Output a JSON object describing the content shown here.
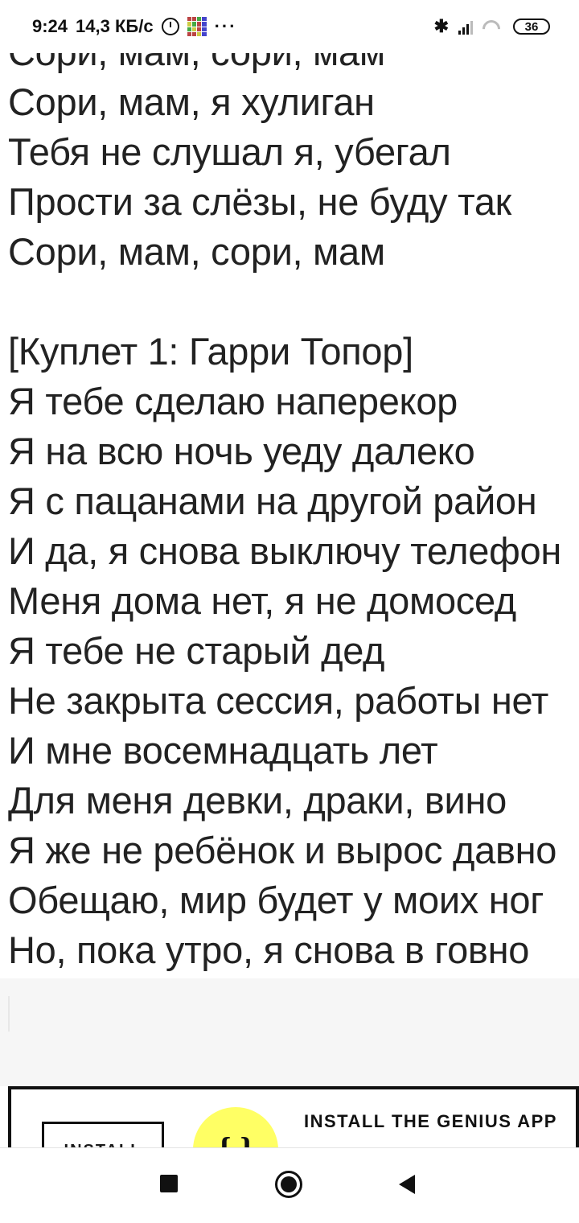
{
  "status_bar": {
    "time": "9:24",
    "speed": "14,3 КБ/с",
    "overflow": "···",
    "battery": "36",
    "icons": [
      "alarm-icon",
      "app-notification-icon",
      "bluetooth-icon",
      "signal-icon",
      "wifi-icon",
      "battery-icon"
    ]
  },
  "lyrics": {
    "partial_top_line": "Сори, мам, сори, мам",
    "chorus_end": [
      "Сори, мам, я хулиган",
      "Тебя не слушал я, убегал",
      "Прости за слёзы, не буду так",
      "Сори, мам, сори, мам"
    ],
    "section_header": "[Куплет 1: Гарри Топор]",
    "verse_1": [
      "Я тебе сделаю наперекор",
      "Я на всю ночь уеду далеко",
      "Я с пацанами на другой район",
      "И да, я снова выключу телефон",
      "Меня дома нет, я не домосед",
      "Я тебе не старый дед",
      "Не закрыта сессия, работы нет",
      "И мне восемнадцать лет",
      "Для меня девки, драки, вино",
      "Я же не ребёнок и вырос давно",
      "Обещаю, мир будет у моих ног",
      "Но, пока утро, я снова в говно"
    ]
  },
  "promo": {
    "button_label": "INSTALL",
    "title": "INSTALL THE GENIUS APP",
    "logo_color": "#ffff64"
  },
  "nav": {
    "icons": [
      "recents-icon",
      "home-icon",
      "back-icon"
    ]
  }
}
